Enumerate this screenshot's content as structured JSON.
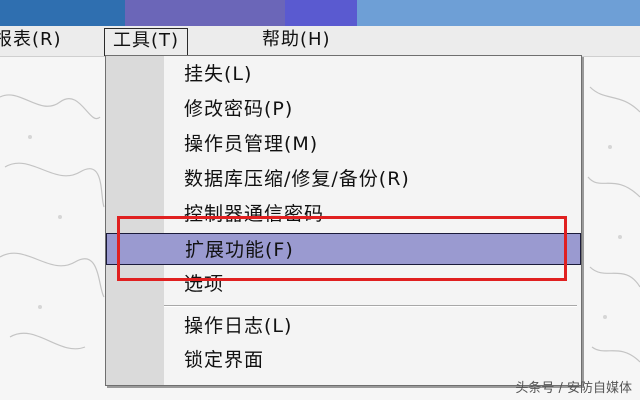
{
  "colors": {
    "strip": [
      "#2f6fb0",
      "#6b66b8",
      "#5a5ad0",
      "#6e9fd6"
    ],
    "highlight": "#9a9ad0",
    "annotation": "#e02020"
  },
  "menubar": {
    "items": [
      {
        "label": "报表(R)"
      },
      {
        "label": "工具(T)"
      },
      {
        "label": "帮助(H)"
      }
    ],
    "active_index": 1
  },
  "dropdown": {
    "items": [
      {
        "label": "挂失(L)"
      },
      {
        "label": "修改密码(P)"
      },
      {
        "label": "操作员管理(M)"
      },
      {
        "label": "数据库压缩/修复/备份(R)"
      },
      {
        "label": "控制器通信密码"
      },
      {
        "label": "扩展功能(F)"
      },
      {
        "label": "选项"
      },
      {
        "label": "操作日志(L)"
      },
      {
        "label": "锁定界面"
      }
    ],
    "highlighted_index": 5
  },
  "watermark": "头条号 / 安防自媒体"
}
